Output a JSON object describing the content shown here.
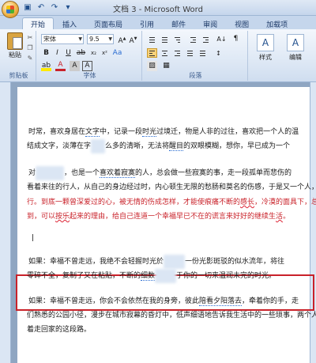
{
  "title": "文档 3 - Microsoft Word",
  "tabs": [
    "开始",
    "插入",
    "页面布局",
    "引用",
    "邮件",
    "审阅",
    "视图",
    "加载项"
  ],
  "ribbon": {
    "paste_label": "粘贴",
    "clipboard_label": "剪贴板",
    "font_name": "宋体",
    "font_size": "9.5",
    "font_group_label": "字体",
    "paragraph_group_label": "段落",
    "style_label": "样式",
    "edit_label": "编辑",
    "style_big_1": "A",
    "style_big_2": "A"
  },
  "document": {
    "p1_line1_a": "时常，喜欢身居在",
    "p1_line1_b": "文字",
    "p1_line1_c": "中，记录一段",
    "p1_line1_d": "时光",
    "p1_line1_e": "过境迁，物是人非的过往，喜欢把一个人的温",
    "p1_line2_a": "结成文字，淡薄在字",
    "p1_line2_c": "么多的清晰，无法将",
    "p1_line2_d": "醒目",
    "p1_line2_e": "的双眼模糊，想你，早已成为一个",
    "p2_line1_a": "对",
    "p2_line1_c": "，也是一个",
    "p2_line1_d": "喜欢着寂寞",
    "p2_line1_e": "的人，总会做一些寂寞的事，走一段孤单而悲伤的",
    "p2_line2_a": "看着来往的行人，从自己的身边经过时，内心顿生无限的愁肠和莫名的伤感，于是又一个人，",
    "p3_line1_a": "行。到底一颗曾深爱过的心，被无情的伤成怎样，才能使痕痛不断的",
    "p3_line1_b": "感长",
    "p3_line1_c": "，冷漠的面具下，总",
    "p3_line2_a": "到，可以",
    "p3_line2_b": "按乐",
    "p3_line2_c": "起来的理由，给自己连道一个幸福早已不在的谎言来好好的继续生",
    "p3_line2_d": "活",
    "p3_line2_e": "。",
    "p4_line1_a": "如果：幸福不曾走远，我绝不会轻握时光於",
    "p4_line1_c": "一份光影斑驳的似水流年，将往",
    "p4_line2_a": "零碎不全，复制了又在粘贴，不断的",
    "p4_line2_b": "细数",
    "p4_line2_c": "于你的一切来温润未完的时光。",
    "p5_line1_a": "如果：幸福不曾走远，你会不会依然在我的身旁，彼此",
    "p5_line1_b": "陪看夕阳落去",
    "p5_line1_c": "，牵着你的手，走",
    "p5_line2_a": "们熟悉的公园小径，漫步在城市寂幕的昏灯中，低声细语地告诉我生活中的一些琐事，两个人",
    "p5_line3_a": "着走回家的这段路。"
  }
}
